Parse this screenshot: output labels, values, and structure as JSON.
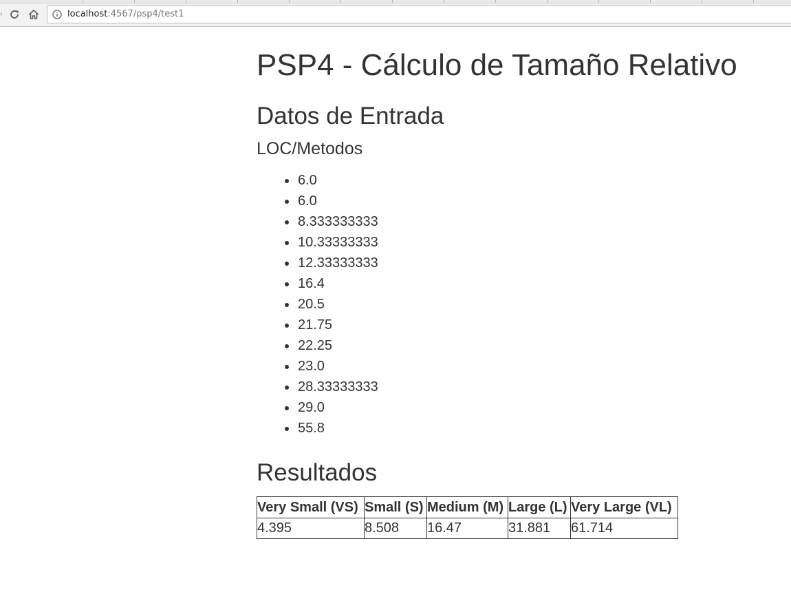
{
  "browser": {
    "url_host": "localhost",
    "url_rest": ":4567/psp4/test1"
  },
  "page": {
    "title": "PSP4 - Cálculo de Tamaño Relativo",
    "input_heading": "Datos de Entrada",
    "list_heading": "LOC/Metodos",
    "values": [
      "6.0",
      "6.0",
      "8.333333333",
      "10.33333333",
      "12.33333333",
      "16.4",
      "20.5",
      "21.75",
      "22.25",
      "23.0",
      "28.33333333",
      "29.0",
      "55.8"
    ],
    "results_heading": "Resultados",
    "table": {
      "headers": [
        "Very Small (VS)",
        "Small (S)",
        "Medium (M)",
        "Large (L)",
        "Very Large (VL)"
      ],
      "row": [
        "4.395",
        "8.508",
        "16.47",
        "31.881",
        "61.714"
      ]
    }
  }
}
